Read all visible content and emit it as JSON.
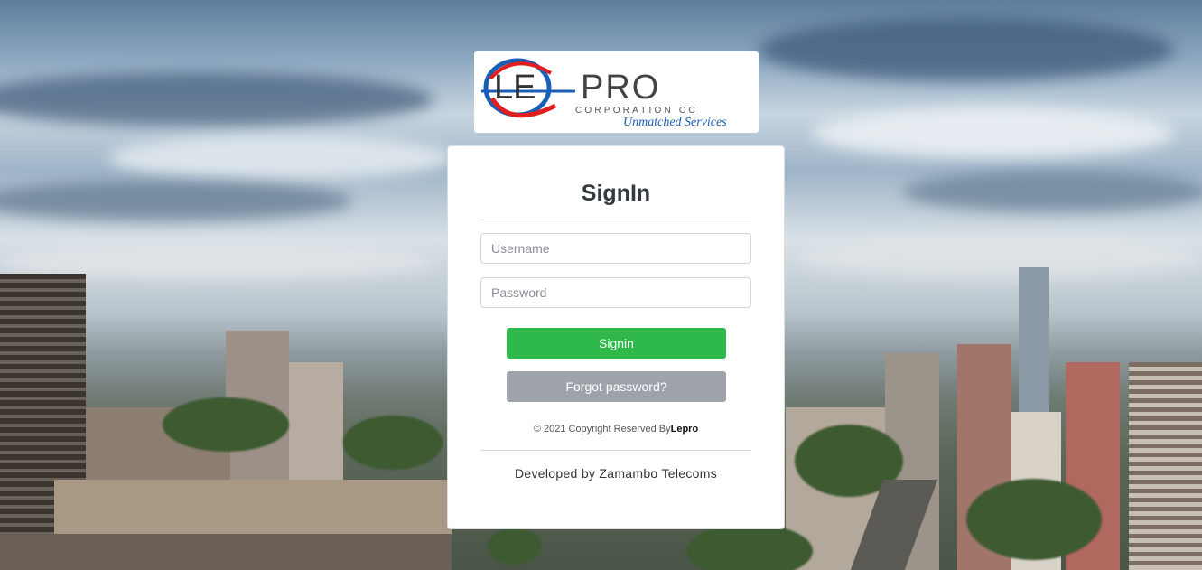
{
  "logo": {
    "brand_le": "LE",
    "brand_pro": "PRO",
    "corporation": "CORPORATION CC",
    "tagline": "Unmatched Services"
  },
  "signin": {
    "title": "SignIn",
    "username_placeholder": "Username",
    "password_placeholder": "Password",
    "signin_label": "Signin",
    "forgot_label": "Forgot password?",
    "copyright_prefix": "© 2021 Copyright Reserved By",
    "copyright_brand": "Lepro",
    "developed_by": "Developed by Zamambo Telecoms"
  },
  "colors": {
    "signin_button": "#2fb94b",
    "forgot_button": "#9ea3ab",
    "logo_red": "#e02020",
    "logo_blue": "#1a5fb4"
  }
}
